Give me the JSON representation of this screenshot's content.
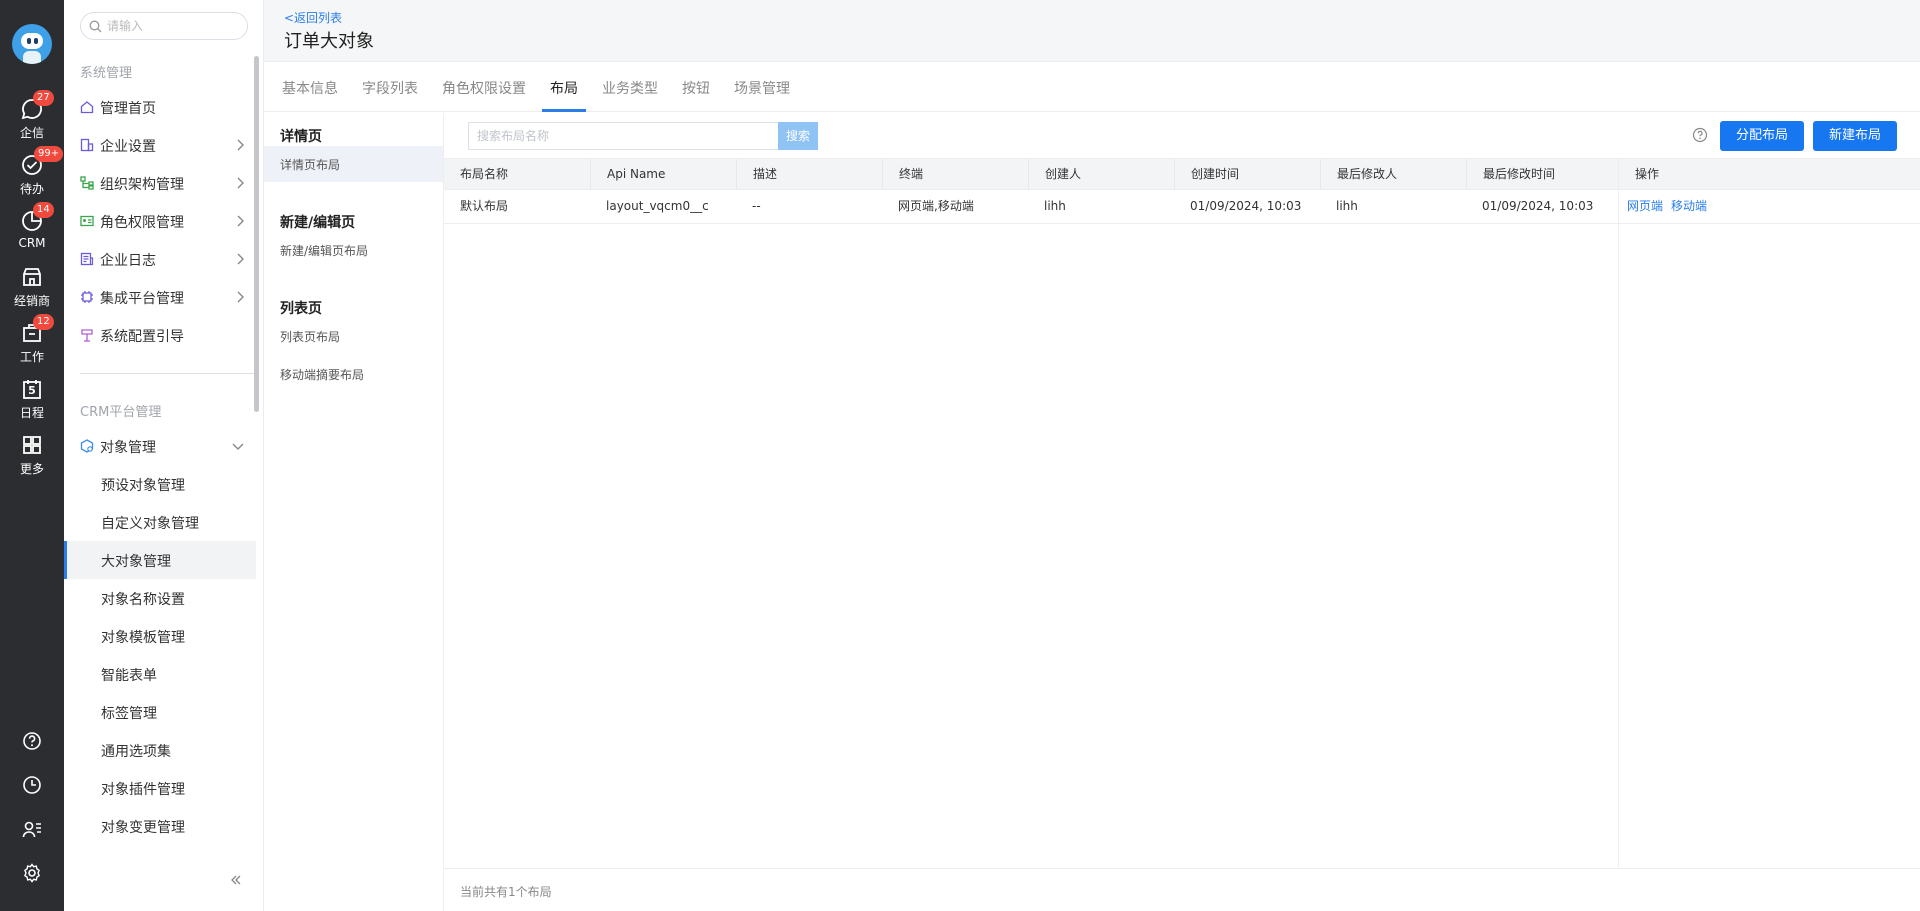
{
  "rail": {
    "items": [
      {
        "label": "企信",
        "badge": "27"
      },
      {
        "label": "待办",
        "badge": "99+"
      },
      {
        "label": "CRM",
        "badge": "14"
      },
      {
        "label": "经销商",
        "badge": ""
      },
      {
        "label": "工作",
        "badge": "12"
      },
      {
        "label": "日程",
        "badge": "",
        "day": "5"
      },
      {
        "label": "更多",
        "badge": ""
      }
    ]
  },
  "sidebar": {
    "search_placeholder": "请输入",
    "section1": "系统管理",
    "items": [
      {
        "label": "管理首页"
      },
      {
        "label": "企业设置"
      },
      {
        "label": "组织架构管理"
      },
      {
        "label": "角色权限管理"
      },
      {
        "label": "企业日志"
      },
      {
        "label": "集成平台管理"
      },
      {
        "label": "系统配置引导"
      }
    ],
    "section2": "CRM平台管理",
    "object_mgmt": "对象管理",
    "sub_items": [
      {
        "label": "预设对象管理"
      },
      {
        "label": "自定义对象管理"
      },
      {
        "label": "大对象管理"
      },
      {
        "label": "对象名称设置"
      },
      {
        "label": "对象模板管理"
      },
      {
        "label": "智能表单"
      },
      {
        "label": "标签管理"
      },
      {
        "label": "通用选项集"
      },
      {
        "label": "对象插件管理"
      },
      {
        "label": "对象变更管理"
      }
    ]
  },
  "header": {
    "back": "<返回列表",
    "title": "订单大对象"
  },
  "tabs": [
    {
      "label": "基本信息"
    },
    {
      "label": "字段列表"
    },
    {
      "label": "角色权限设置"
    },
    {
      "label": "布局"
    },
    {
      "label": "业务类型"
    },
    {
      "label": "按钮"
    },
    {
      "label": "场景管理"
    }
  ],
  "left_panel": {
    "group1": "详情页",
    "item1": "详情页布局",
    "group2": "新建/编辑页",
    "item2": "新建/编辑页布局",
    "group3": "列表页",
    "item3": "列表页布局",
    "item4": "移动端摘要布局"
  },
  "toolbar": {
    "search_placeholder": "搜索布局名称",
    "search_btn": "搜索",
    "assign_btn": "分配布局",
    "new_btn": "新建布局"
  },
  "table": {
    "headers": [
      "布局名称",
      "Api Name",
      "描述",
      "终端",
      "创建人",
      "创建时间",
      "最后修改人",
      "最后修改时间",
      "操作"
    ],
    "rows": [
      {
        "name": "默认布局",
        "api": "layout_vqcm0__c",
        "desc": "--",
        "terminal": "网页端,移动端",
        "creator": "lihh",
        "created": "01/09/2024, 10:03",
        "modifier": "lihh",
        "modified": "01/09/2024, 10:03",
        "op1": "网页端",
        "op2": "移动端"
      }
    ]
  },
  "footer": "当前共有1个布局",
  "colors": {
    "rail_bg": "#2b2d31",
    "accent": "#1677f0",
    "badge": "#f04a3e"
  }
}
